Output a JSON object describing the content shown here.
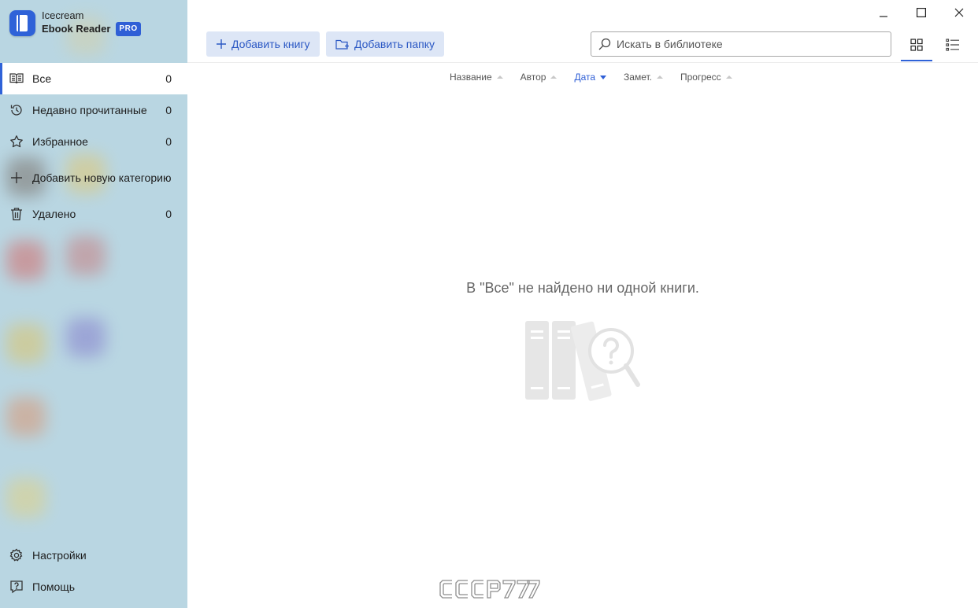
{
  "app": {
    "name_line1": "Icecream",
    "name_line2": "Ebook Reader",
    "badge": "PRO",
    "accent_color": "#2f62d8",
    "sidebar_color": "#b9d6e2"
  },
  "sidebar": {
    "items": [
      {
        "label": "Все",
        "count": "0",
        "icon": "book-open-icon",
        "active": true
      },
      {
        "label": "Недавно прочитанные",
        "count": "0",
        "icon": "history-icon"
      },
      {
        "label": "Избранное",
        "count": "0",
        "icon": "star-icon"
      },
      {
        "label": "Добавить новую категорию",
        "count": "",
        "icon": "plus-icon"
      },
      {
        "label": "Удалено",
        "count": "0",
        "icon": "trash-icon"
      }
    ],
    "bottom": [
      {
        "label": "Настройки",
        "icon": "gear-icon"
      },
      {
        "label": "Помощь",
        "icon": "help-icon"
      }
    ]
  },
  "toolbar": {
    "add_book": "Добавить книгу",
    "add_folder": "Добавить папку",
    "search_placeholder": "Искать в библиотеке",
    "view_mode": "grid"
  },
  "sort": {
    "columns": [
      "Название",
      "Автор",
      "Дата",
      "Замет.",
      "Прогресс"
    ],
    "active": "Дата",
    "direction": "descending"
  },
  "empty_state": {
    "message": "В \"Все\" не найдено ни одной книги."
  },
  "watermark": "CCCP777"
}
